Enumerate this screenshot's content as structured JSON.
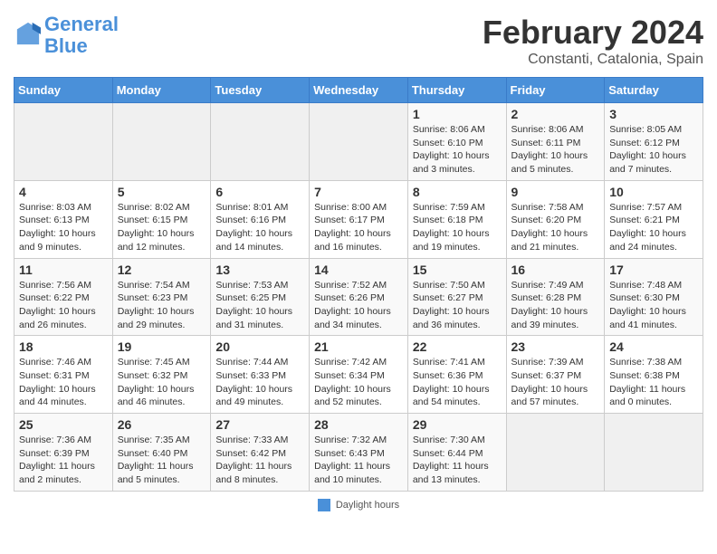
{
  "logo": {
    "line1": "General",
    "line2": "Blue"
  },
  "title": "February 2024",
  "subtitle": "Constanti, Catalonia, Spain",
  "days_of_week": [
    "Sunday",
    "Monday",
    "Tuesday",
    "Wednesday",
    "Thursday",
    "Friday",
    "Saturday"
  ],
  "weeks": [
    [
      {
        "num": "",
        "info": ""
      },
      {
        "num": "",
        "info": ""
      },
      {
        "num": "",
        "info": ""
      },
      {
        "num": "",
        "info": ""
      },
      {
        "num": "1",
        "info": "Sunrise: 8:06 AM\nSunset: 6:10 PM\nDaylight: 10 hours\nand 3 minutes."
      },
      {
        "num": "2",
        "info": "Sunrise: 8:06 AM\nSunset: 6:11 PM\nDaylight: 10 hours\nand 5 minutes."
      },
      {
        "num": "3",
        "info": "Sunrise: 8:05 AM\nSunset: 6:12 PM\nDaylight: 10 hours\nand 7 minutes."
      }
    ],
    [
      {
        "num": "4",
        "info": "Sunrise: 8:03 AM\nSunset: 6:13 PM\nDaylight: 10 hours\nand 9 minutes."
      },
      {
        "num": "5",
        "info": "Sunrise: 8:02 AM\nSunset: 6:15 PM\nDaylight: 10 hours\nand 12 minutes."
      },
      {
        "num": "6",
        "info": "Sunrise: 8:01 AM\nSunset: 6:16 PM\nDaylight: 10 hours\nand 14 minutes."
      },
      {
        "num": "7",
        "info": "Sunrise: 8:00 AM\nSunset: 6:17 PM\nDaylight: 10 hours\nand 16 minutes."
      },
      {
        "num": "8",
        "info": "Sunrise: 7:59 AM\nSunset: 6:18 PM\nDaylight: 10 hours\nand 19 minutes."
      },
      {
        "num": "9",
        "info": "Sunrise: 7:58 AM\nSunset: 6:20 PM\nDaylight: 10 hours\nand 21 minutes."
      },
      {
        "num": "10",
        "info": "Sunrise: 7:57 AM\nSunset: 6:21 PM\nDaylight: 10 hours\nand 24 minutes."
      }
    ],
    [
      {
        "num": "11",
        "info": "Sunrise: 7:56 AM\nSunset: 6:22 PM\nDaylight: 10 hours\nand 26 minutes."
      },
      {
        "num": "12",
        "info": "Sunrise: 7:54 AM\nSunset: 6:23 PM\nDaylight: 10 hours\nand 29 minutes."
      },
      {
        "num": "13",
        "info": "Sunrise: 7:53 AM\nSunset: 6:25 PM\nDaylight: 10 hours\nand 31 minutes."
      },
      {
        "num": "14",
        "info": "Sunrise: 7:52 AM\nSunset: 6:26 PM\nDaylight: 10 hours\nand 34 minutes."
      },
      {
        "num": "15",
        "info": "Sunrise: 7:50 AM\nSunset: 6:27 PM\nDaylight: 10 hours\nand 36 minutes."
      },
      {
        "num": "16",
        "info": "Sunrise: 7:49 AM\nSunset: 6:28 PM\nDaylight: 10 hours\nand 39 minutes."
      },
      {
        "num": "17",
        "info": "Sunrise: 7:48 AM\nSunset: 6:30 PM\nDaylight: 10 hours\nand 41 minutes."
      }
    ],
    [
      {
        "num": "18",
        "info": "Sunrise: 7:46 AM\nSunset: 6:31 PM\nDaylight: 10 hours\nand 44 minutes."
      },
      {
        "num": "19",
        "info": "Sunrise: 7:45 AM\nSunset: 6:32 PM\nDaylight: 10 hours\nand 46 minutes."
      },
      {
        "num": "20",
        "info": "Sunrise: 7:44 AM\nSunset: 6:33 PM\nDaylight: 10 hours\nand 49 minutes."
      },
      {
        "num": "21",
        "info": "Sunrise: 7:42 AM\nSunset: 6:34 PM\nDaylight: 10 hours\nand 52 minutes."
      },
      {
        "num": "22",
        "info": "Sunrise: 7:41 AM\nSunset: 6:36 PM\nDaylight: 10 hours\nand 54 minutes."
      },
      {
        "num": "23",
        "info": "Sunrise: 7:39 AM\nSunset: 6:37 PM\nDaylight: 10 hours\nand 57 minutes."
      },
      {
        "num": "24",
        "info": "Sunrise: 7:38 AM\nSunset: 6:38 PM\nDaylight: 11 hours\nand 0 minutes."
      }
    ],
    [
      {
        "num": "25",
        "info": "Sunrise: 7:36 AM\nSunset: 6:39 PM\nDaylight: 11 hours\nand 2 minutes."
      },
      {
        "num": "26",
        "info": "Sunrise: 7:35 AM\nSunset: 6:40 PM\nDaylight: 11 hours\nand 5 minutes."
      },
      {
        "num": "27",
        "info": "Sunrise: 7:33 AM\nSunset: 6:42 PM\nDaylight: 11 hours\nand 8 minutes."
      },
      {
        "num": "28",
        "info": "Sunrise: 7:32 AM\nSunset: 6:43 PM\nDaylight: 11 hours\nand 10 minutes."
      },
      {
        "num": "29",
        "info": "Sunrise: 7:30 AM\nSunset: 6:44 PM\nDaylight: 11 hours\nand 13 minutes."
      },
      {
        "num": "",
        "info": ""
      },
      {
        "num": "",
        "info": ""
      }
    ]
  ],
  "legend": {
    "label": "Daylight hours"
  }
}
